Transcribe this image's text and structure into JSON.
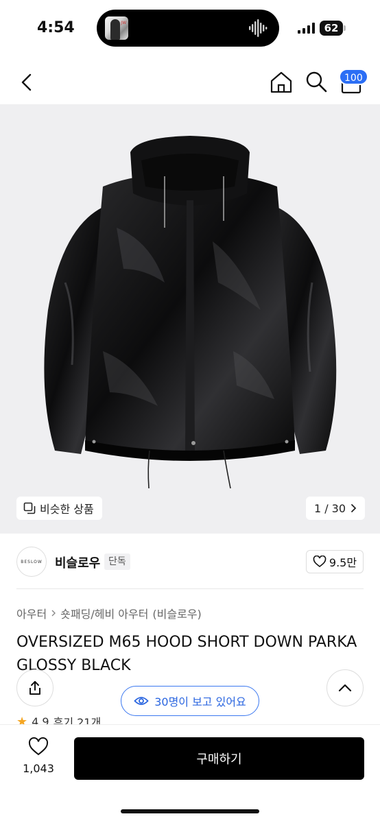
{
  "status_bar": {
    "time": "4:54",
    "battery": "62"
  },
  "nav": {
    "cart_badge": "100"
  },
  "gallery": {
    "similar_label": "비슷한 상품",
    "pager": "1 / 30"
  },
  "brand": {
    "logo_text": "BESLOW",
    "name": "비슬로우",
    "badge": "단독",
    "likes": "9.5만"
  },
  "breadcrumb": {
    "category": "아우터",
    "subcategory": "숏패딩/헤비 아우터",
    "brand": "(비슬로우)"
  },
  "product": {
    "title": "OVERSIZED M65 HOOD SHORT DOWN PARKA GLOSSY BLACK"
  },
  "rating": {
    "score": "4.9",
    "reviews": "후기 21개"
  },
  "viewers": {
    "text": "30명이 보고 있어요"
  },
  "bottom": {
    "wish_count": "1,043",
    "buy_label": "구매하기"
  },
  "colors": {
    "accent": "#2b6ef5",
    "buy_button": "#000000",
    "star": "#f5a623"
  }
}
